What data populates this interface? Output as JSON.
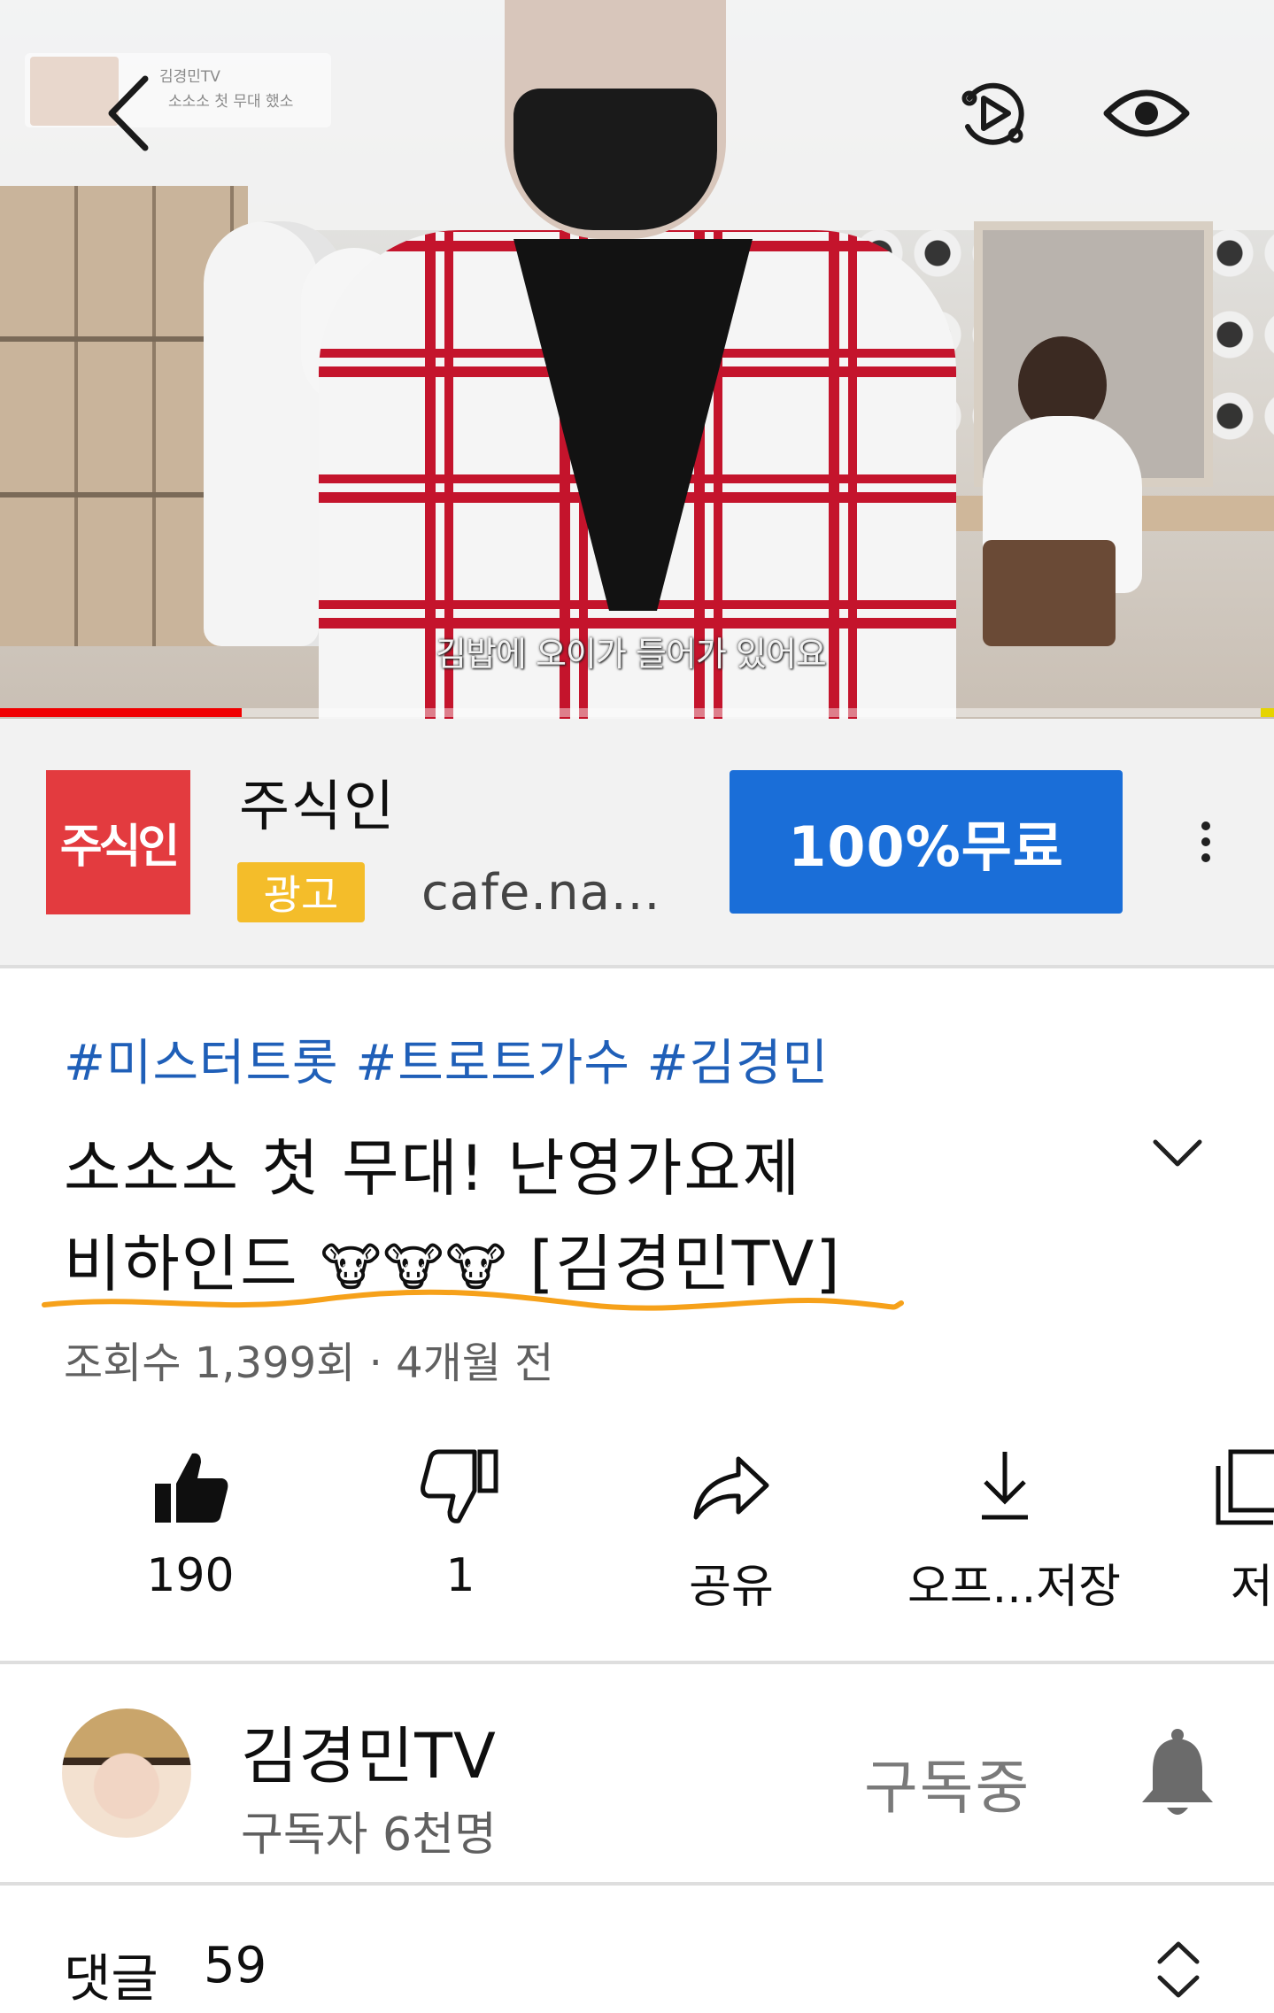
{
  "video": {
    "thumbnail_badge": {
      "line1": "김경민TV",
      "line2": "소소소 첫 무대 했소"
    },
    "subtitle": "김밥에 오이가 들어가 있어요",
    "progress_fraction": 0.19,
    "icons": {
      "back": "back-arrow-icon",
      "autoplay": "autoplay-icon",
      "visibility": "eye-icon"
    }
  },
  "ad": {
    "logo_text": "주식인",
    "name": "주식인",
    "badge": "광고",
    "url": "cafe.na...",
    "cta": "100%무료",
    "colors": {
      "logo_bg": "#e33b3f",
      "badge_bg": "#f4bd2a",
      "cta_bg": "#1a6ed8"
    }
  },
  "video_info": {
    "tags": "#미스터트롯 #트로트가수 #김경민",
    "title_line1": "소소소 첫 무대! 난영가요제",
    "title_line2_text": "비하인드",
    "title_line2_emoji": "🐮🐮🐮",
    "title_line2_suffix": "[김경민TV]",
    "views": "조회수 1,399회 · 4개월 전",
    "underline_color": "#f6a11a",
    "tag_color": "#1f5fb8"
  },
  "actions": {
    "like": {
      "label": "190",
      "icon": "thumbs-up-filled-icon"
    },
    "dislike": {
      "label": "1",
      "icon": "thumbs-down-icon"
    },
    "share": {
      "label": "공유",
      "icon": "share-arrow-icon"
    },
    "download": {
      "label": "오프...저장",
      "icon": "download-icon"
    },
    "save": {
      "label": "저",
      "icon": "save-playlist-icon"
    }
  },
  "channel": {
    "name": "김경민TV",
    "subscribers": "구독자 6천명",
    "subscribe_state": "구독중",
    "bell_icon": "bell-icon"
  },
  "comments": {
    "label": "댓글",
    "count": "59",
    "toggle_icon": "expand-collapse-icon"
  }
}
